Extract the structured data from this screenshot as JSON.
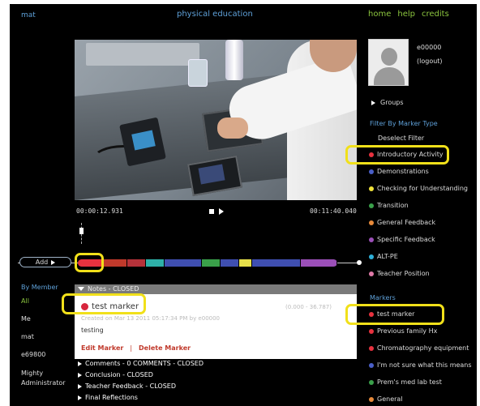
{
  "header": {
    "left_link": "mat",
    "title": "physical education",
    "nav": [
      "home",
      "help",
      "credits"
    ]
  },
  "player": {
    "time_current": "00:00:12.931",
    "time_total": "00:11:40.040"
  },
  "timeline": {
    "add_label": "Add",
    "segments": [
      {
        "color": "#e8323f",
        "flex": 2
      },
      {
        "color": "#c0392b",
        "flex": 2
      },
      {
        "color": "#b5323a",
        "flex": 1.5
      },
      {
        "color": "#2eb0a8",
        "flex": 1.5
      },
      {
        "color": "#3f4fb0",
        "flex": 3
      },
      {
        "color": "#3aa04a",
        "flex": 1.5
      },
      {
        "color": "#3f4fb0",
        "flex": 1.5
      },
      {
        "color": "#e6e04a",
        "flex": 1
      },
      {
        "color": "#3f4fb0",
        "flex": 4
      },
      {
        "color": "#9b4fb8",
        "flex": 3
      }
    ]
  },
  "members": {
    "heading": "By Member",
    "items": [
      "All",
      "Me",
      "mat",
      "e69800",
      "Mighty",
      "Administrator"
    ]
  },
  "notes": {
    "header": "Notes - CLOSED",
    "marker_title": "test marker",
    "marker_range": "(0.000 - 36.787)",
    "meta": "Created on Mar 13 2011 05:17:34 PM by e00000",
    "text": "testing",
    "edit_label": "Edit Marker",
    "separator": "|",
    "delete_label": "Delete Marker",
    "marker_color": "#d7263d"
  },
  "sections": [
    {
      "label": "Comments - 0 COMMENTS - CLOSED",
      "color": "#6b6b6b"
    },
    {
      "label": "Conclusion - CLOSED",
      "color": "#6aa845"
    },
    {
      "label": "Teacher Feedback - CLOSED",
      "color": "#c42b2b"
    },
    {
      "label": "Final Reflections",
      "color": "#3b78b8"
    }
  ],
  "user": {
    "id": "e00000",
    "logout": "(logout)"
  },
  "right": {
    "groups_label": "Groups",
    "filter_heading": "Filter By Marker Type",
    "deselect_label": "Deselect Filter",
    "marker_types": [
      {
        "label": "Introductory Activity",
        "color": "#e8323f"
      },
      {
        "label": "Demonstrations",
        "color": "#4a5fc8"
      },
      {
        "label": "Checking for Understanding",
        "color": "#f0e23a"
      },
      {
        "label": "Transition",
        "color": "#3aa04a"
      },
      {
        "label": "General Feedback",
        "color": "#e88a3a"
      },
      {
        "label": "Specific Feedback",
        "color": "#9b4fb8"
      },
      {
        "label": "ALT-PE",
        "color": "#2eb0d8"
      },
      {
        "label": "Teacher Position",
        "color": "#e07aa8"
      }
    ],
    "markers_heading": "Markers",
    "markers": [
      {
        "label": "test marker",
        "color": "#e8323f"
      },
      {
        "label": "Previous family Hx",
        "color": "#e8323f"
      },
      {
        "label": "Chromatography equipment",
        "color": "#e8323f"
      },
      {
        "label": "I'm not sure what this means",
        "color": "#4a5fc8"
      },
      {
        "label": "Prem's med lab test",
        "color": "#3aa04a"
      },
      {
        "label": "General",
        "color": "#e88a3a"
      }
    ]
  }
}
